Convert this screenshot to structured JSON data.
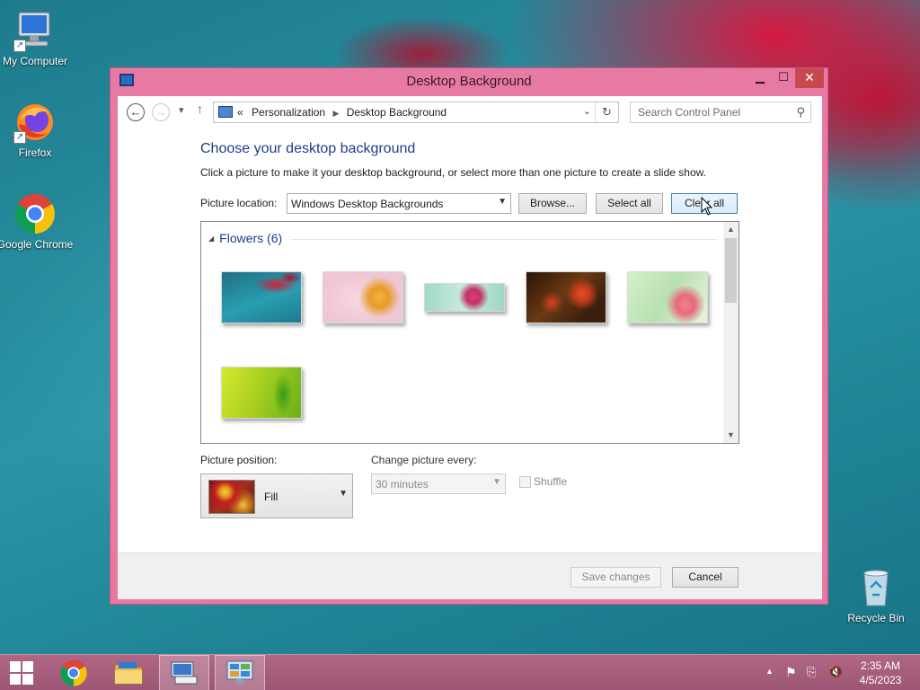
{
  "desktop": {
    "icons": [
      {
        "label": "My Computer"
      },
      {
        "label": "Firefox"
      },
      {
        "label": "Google Chrome"
      },
      {
        "label": "Recycle Bin"
      }
    ]
  },
  "window": {
    "title": "Desktop Background",
    "nav": {
      "breadcrumb_overflow": "«",
      "breadcrumb": [
        "Personalization",
        "Desktop Background"
      ],
      "search_placeholder": "Search Control Panel"
    },
    "heading": "Choose your desktop background",
    "description": "Click a picture to make it your desktop background, or select more than one picture to create a slide show.",
    "picture_location": {
      "label": "Picture location:",
      "value": "Windows Desktop Backgrounds"
    },
    "buttons": {
      "browse": "Browse...",
      "select_all": "Select all",
      "clear_all": "Clear all",
      "save_changes": "Save changes",
      "cancel": "Cancel"
    },
    "gallery": {
      "group_label": "Flowers (6)",
      "thumbnails": [
        {
          "name": "flower-1"
        },
        {
          "name": "flower-2"
        },
        {
          "name": "flower-3"
        },
        {
          "name": "flower-4"
        },
        {
          "name": "flower-5"
        },
        {
          "name": "flower-6"
        }
      ]
    },
    "picture_position": {
      "label": "Picture position:",
      "value": "Fill"
    },
    "change_picture": {
      "label": "Change picture every:",
      "value": "30 minutes"
    },
    "shuffle": {
      "label": "Shuffle",
      "checked": false
    }
  },
  "taskbar": {
    "time": "2:35 AM",
    "date": "4/5/2023"
  },
  "colors": {
    "window_frame": "#e77aa2",
    "heading_blue": "#1e3f8a",
    "taskbar": "#a35b7b",
    "close_button": "#c7494f"
  }
}
